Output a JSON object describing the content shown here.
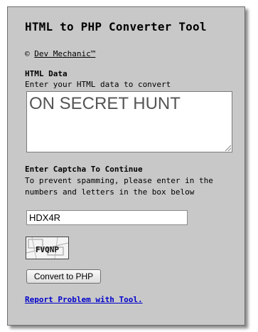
{
  "title": "HTML to PHP Converter Tool",
  "copyright": {
    "symbol": "©",
    "link_text": "Dev Mechanic™"
  },
  "html_data": {
    "label": "HTML Data",
    "instruction": "Enter your HTML data to convert",
    "value": "ON SECRET HUNT"
  },
  "captcha": {
    "label": "Enter Captcha To Continue",
    "instruction": "To prevent spamming, please enter in the numbers and letters in the box below",
    "input_value": "HDX4R",
    "image_text": "FVQNP"
  },
  "convert_button": "Convert to PHP",
  "report_link": "Report Problem with Tool."
}
